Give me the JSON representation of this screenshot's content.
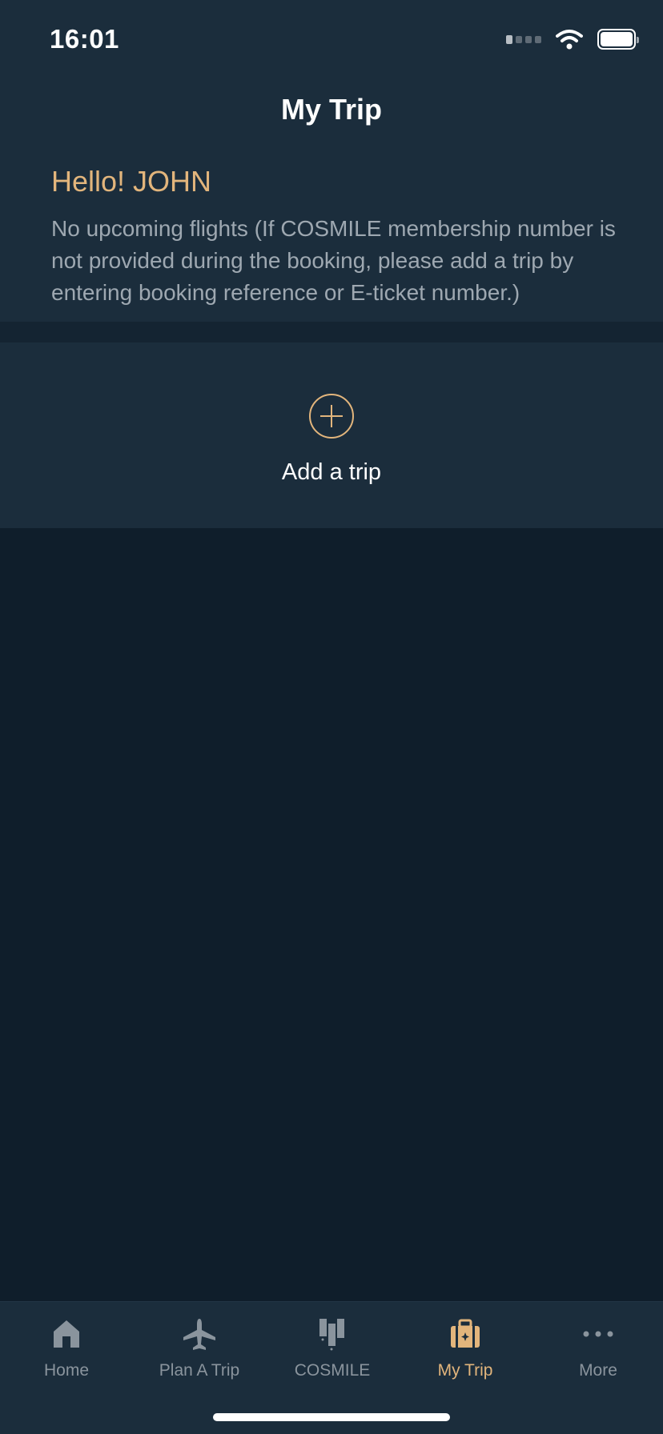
{
  "status_bar": {
    "time": "16:01"
  },
  "header": {
    "title": "My Trip"
  },
  "greeting": "Hello! JOHN",
  "info_text": "No upcoming flights (If COSMILE membership number is not provided during the booking, please add a trip by entering booking reference or E-ticket number.)",
  "add_trip": {
    "label": "Add a trip",
    "icon": "plus-circle-icon"
  },
  "tabs": [
    {
      "label": "Home",
      "icon": "home-icon",
      "active": false
    },
    {
      "label": "Plan A Trip",
      "icon": "airplane-icon",
      "active": false
    },
    {
      "label": "COSMILE",
      "icon": "cosmile-icon",
      "active": false
    },
    {
      "label": "My Trip",
      "icon": "suitcase-icon",
      "active": true
    },
    {
      "label": "More",
      "icon": "more-icon",
      "active": false
    }
  ],
  "colors": {
    "accent": "#e2b57c",
    "header_bg": "#1b2d3c",
    "page_bg": "#0f1e2b",
    "inactive_tab": "#8a949d"
  }
}
